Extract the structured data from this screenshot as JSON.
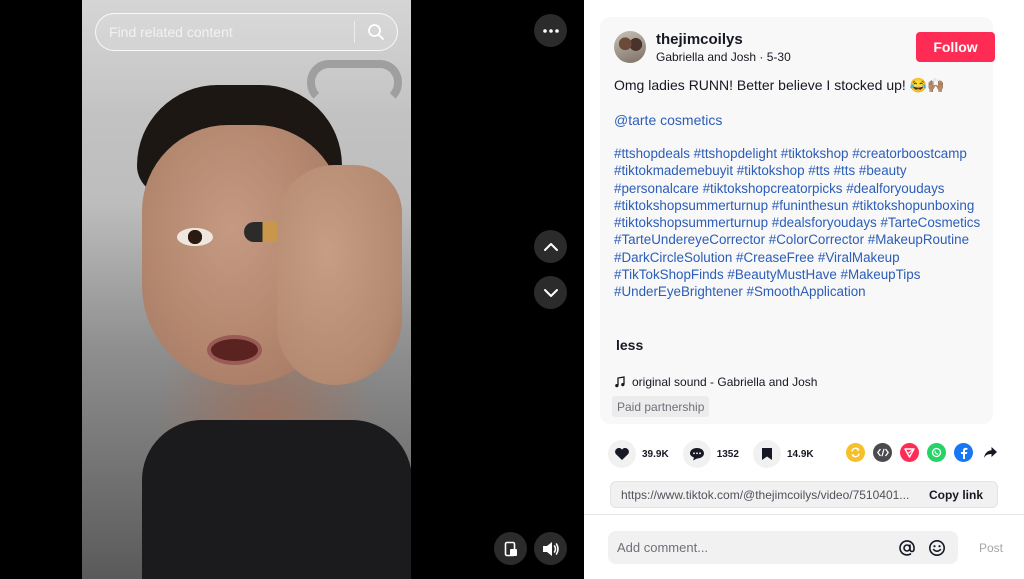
{
  "video": {
    "search_placeholder": "Find related content"
  },
  "author": {
    "username": "thejimcoilys",
    "display_name": "Gabriella and Josh",
    "date": "5-30",
    "separator": " · "
  },
  "follow_label": "Follow",
  "description": {
    "caption": "Omg ladies RUNN! Better believe I stocked up! 😂🙌🏽",
    "mention": "@tarte cosmetics",
    "hashtags": "#ttshopdeals #ttshopdelight #tiktokshop #creatorboostcamp #tiktokmademebuyit #tiktokshop #tts #tts #beauty #personalcare #tiktokshopcreatorpicks #dealforyoudays #tiktokshopsummerturnup #funinthesun #tiktokshopunboxing #tiktokshopsummerturnup #dealsforyoudays #TarteCosmetics #TarteUndereyeCorrector #ColorCorrector #MakeupRoutine #DarkCircleSolution #CreaseFree #ViralMakeup #TikTokShopFinds #BeautyMustHave #MakeupTips #UnderEyeBrightener #SmoothApplication",
    "less_label": "less",
    "sound": "original sound - Gabriella and Josh",
    "paid_label": "Paid partnership"
  },
  "stats": {
    "likes": "39.9K",
    "comments": "1352",
    "saves": "14.9K"
  },
  "share": {
    "colors": {
      "repost": "#f7c02b",
      "embed": "#4a4a4f",
      "send": "#fe2c55",
      "whatsapp": "#25d366",
      "facebook": "#1877f2"
    }
  },
  "link": {
    "url": "https://www.tiktok.com/@thejimcoilys/video/7510401...",
    "copy_label": "Copy link"
  },
  "comment": {
    "placeholder": "Add comment...",
    "post_label": "Post"
  }
}
